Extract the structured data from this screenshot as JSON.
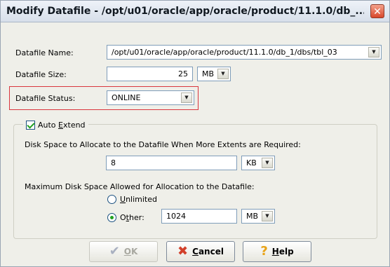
{
  "window": {
    "title": "Modify Datafile - /opt/u01/oracle/app/oracle/product/11.1.0/db_...",
    "close_label": "✕"
  },
  "form": {
    "datafile_name": {
      "label": "Datafile Name:",
      "value": "/opt/u01/oracle/app/oracle/product/11.1.0/db_1/dbs/tbl_03"
    },
    "datafile_size": {
      "label": "Datafile Size:",
      "value": "25",
      "unit": "MB"
    },
    "datafile_status": {
      "label": "Datafile Status:",
      "value": "ONLINE"
    }
  },
  "auto_extend": {
    "checkbox_label_prefix": "Auto ",
    "checkbox_label_accel": "E",
    "checkbox_label_rest": "xtend",
    "checked": true,
    "increment_label": "Disk Space to Allocate to the Datafile When More Extents are Required:",
    "increment_value": "8",
    "increment_unit": "KB",
    "max_label": "Maximum Disk Space Allowed for Allocation to the Datafile:",
    "unlimited_accel": "U",
    "unlimited_rest": "nlimited",
    "other_prefix": "O",
    "other_accel": "t",
    "other_rest": "her:",
    "selected": "other",
    "max_value": "1024",
    "max_unit": "MB"
  },
  "buttons": {
    "ok_accel": "O",
    "ok_rest": "K",
    "cancel_accel": "C",
    "cancel_rest": "ancel",
    "help_accel": "H",
    "help_rest": "elp"
  },
  "icons": {
    "dropdown": "▼",
    "ok": "✔",
    "cancel": "✖",
    "help": "?"
  }
}
